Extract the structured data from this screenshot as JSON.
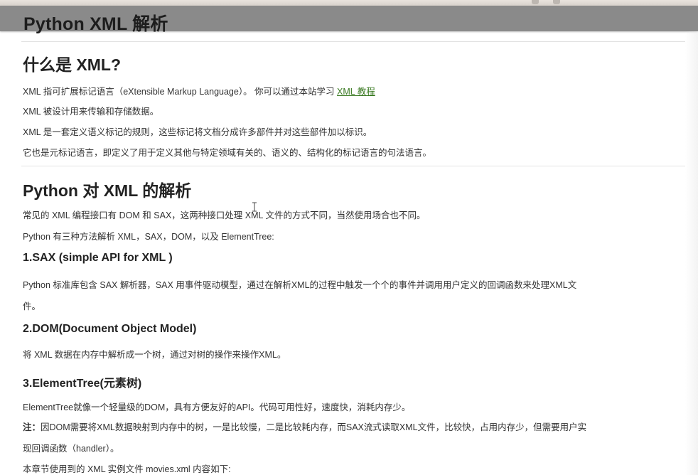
{
  "page_title": "Python XML 解析",
  "section1": {
    "heading": "什么是 XML?",
    "p1_text": "XML 指可扩展标记语言（eXtensible Markup Language）。 你可以通过本站学习 ",
    "p1_link": "XML 教程",
    "p2": "XML 被设计用来传输和存储数据。",
    "p3": "XML 是一套定义语义标记的规则，这些标记将文档分成许多部件并对这些部件加以标识。",
    "p4": "它也是元标记语言，即定义了用于定义其他与特定领域有关的、语义的、结构化的标记语言的句法语言。"
  },
  "section2": {
    "heading": "Python 对 XML 的解析",
    "p1": "常见的 XML 编程接口有 DOM 和 SAX，这两种接口处理 XML 文件的方式不同，当然使用场合也不同。",
    "p2": "Python 有三种方法解析 XML，SAX，DOM，以及 ElementTree:",
    "sax_heading": "1.SAX (simple API for XML )",
    "sax_p_line1": "Python 标准库包含 SAX 解析器，SAX 用事件驱动模型，通过在解析XML的过程中触发一个个的事件并调用用户定义的回调函数来处理XML文",
    "sax_p_line2": "件。",
    "dom_heading": "2.DOM(Document Object Model)",
    "dom_p": "将 XML 数据在内存中解析成一个树，通过对树的操作来操作XML。",
    "et_heading": "3.ElementTree(元素树)",
    "et_p": "ElementTree就像一个轻量级的DOM，具有方便友好的API。代码可用性好，速度快，消耗内存少。",
    "note_label": "注：",
    "note_line1": "因DOM需要将XML数据映射到内存中的树，一是比较慢，二是比较耗内存，而SAX流式读取XML文件，比较快，占用内存少，但需要用户实",
    "note_line2": "现回调函数（handler）。",
    "last_p": "本章节使用到的 XML 实例文件 movies.xml 内容如下:"
  },
  "colors": {
    "link": "#3a7a22",
    "titlebar": "#808080",
    "text": "#333333"
  }
}
